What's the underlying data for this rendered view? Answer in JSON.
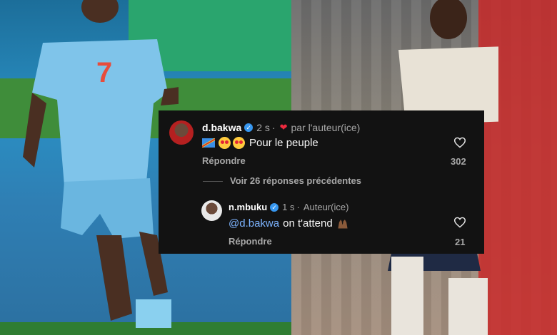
{
  "comment": {
    "username": "d.bakwa",
    "time": "2 s",
    "separator": "·",
    "liked_by_author": "par l'auteur(ice)",
    "text": "Pour le peuple",
    "reply_label": "Répondre",
    "likes": "302"
  },
  "view_replies": "Voir 26 réponses précédentes",
  "reply": {
    "username": "n.mbuku",
    "time": "1 s",
    "separator": "·",
    "author_badge": "Auteur(ice)",
    "mention": "@d.bakwa",
    "text": "on t'attend",
    "reply_label": "Répondre",
    "likes": "21"
  },
  "icons": {
    "verified": "verified-badge-icon",
    "heart": "heart-outline-icon",
    "liked": "red-heart-icon",
    "flag": "drc-flag-emoji",
    "emoji": "heart-eyes-emoji",
    "hands": "raised-hands-emoji"
  },
  "colors": {
    "card_bg": "#121212",
    "mention": "#7db4ff",
    "verified": "#3797f0",
    "liked_heart": "#ed2a3e",
    "secondary_text": "#a8a8a8"
  },
  "jersey_number": "7"
}
